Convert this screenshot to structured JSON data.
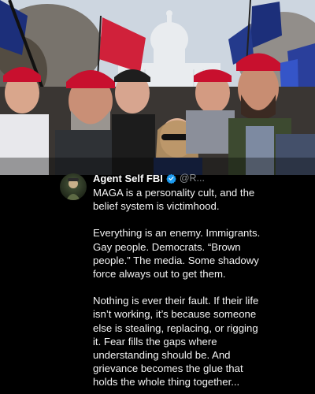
{
  "post": {
    "author_name": "Agent Self FBI",
    "handle": "@R...",
    "verified_color": "#1d9bf0",
    "paragraphs": [
      "MAGA is a personality cult, and the belief system is victimhood.",
      "Everything is an enemy. Immigrants. Gay people. Democrats. “Brown people.” The media. Some shadowy force always out to get them.",
      "Nothing is ever their fault. If their life isn’t working, it’s because someone else is stealing, replacing, or rigging it. Fear fills the gaps where understanding should be. And grievance becomes the glue that holds the whole thing together..."
    ]
  },
  "photo": {
    "description_icon": "crowd-photo"
  },
  "colors": {
    "background": "#000000",
    "text": "#f2f2f2",
    "handle": "#8b8f94",
    "hat_red": "#c8102e"
  }
}
